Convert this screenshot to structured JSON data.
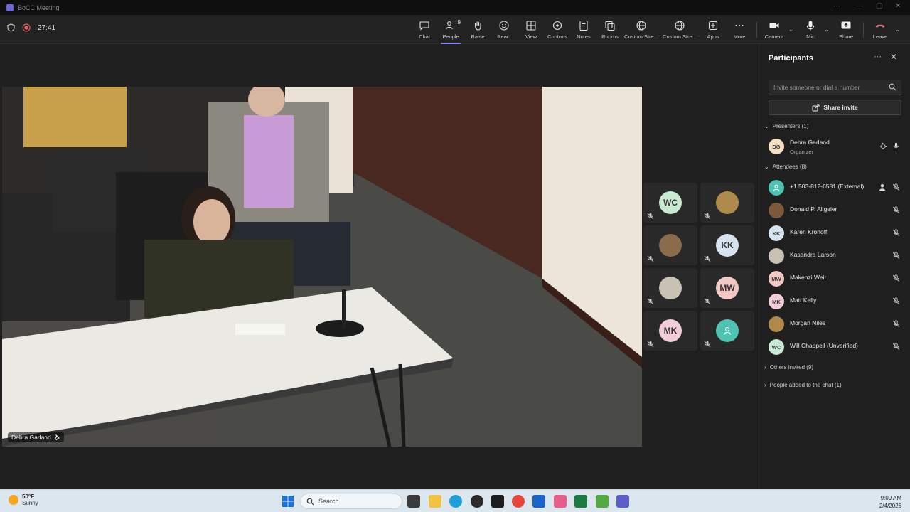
{
  "window": {
    "title": "BoCC Meeting"
  },
  "toolbar": {
    "timer": "27:41",
    "buttons": [
      {
        "label": "Chat",
        "icon": "chat-icon"
      },
      {
        "label": "People",
        "icon": "people-icon",
        "badge": "9",
        "active": true
      },
      {
        "label": "Raise",
        "icon": "raise-hand-icon"
      },
      {
        "label": "React",
        "icon": "react-icon"
      },
      {
        "label": "View",
        "icon": "view-icon"
      },
      {
        "label": "Controls",
        "icon": "controls-icon"
      },
      {
        "label": "Notes",
        "icon": "notes-icon"
      },
      {
        "label": "Rooms",
        "icon": "rooms-icon"
      },
      {
        "label": "Custom Stre...",
        "icon": "globe-icon"
      },
      {
        "label": "Custom Stre...",
        "icon": "globe-icon"
      },
      {
        "label": "Apps",
        "icon": "apps-icon"
      },
      {
        "label": "More",
        "icon": "more-icon"
      }
    ],
    "camera_label": "Camera",
    "mic_label": "Mic",
    "share_label": "Share",
    "leave_label": "Leave",
    "leave_color": "#f1707b"
  },
  "main_video": {
    "speaker_name": "Debra Garland"
  },
  "gallery": [
    {
      "initials": "WC",
      "color": "#c8ead2",
      "photo": false
    },
    {
      "initials": "",
      "color": "#b08a4a",
      "photo": true
    },
    {
      "initials": "",
      "color": "#8a6b4a",
      "photo": true
    },
    {
      "initials": "KK",
      "color": "#d8e3f0",
      "photo": false
    },
    {
      "initials": "",
      "color": "#c9c2b4",
      "photo": true
    },
    {
      "initials": "MW",
      "color": "#f3c9c6",
      "photo": false
    },
    {
      "initials": "MK",
      "color": "#f3ccd9",
      "photo": false
    },
    {
      "initials": "",
      "color": "#4fc3b2",
      "photo": false,
      "icon": "person-icon"
    }
  ],
  "participants_panel": {
    "title": "Participants",
    "invite_placeholder": "Invite someone or dial a number",
    "share_invite_label": "Share invite",
    "presenters_header": "Presenters (1)",
    "presenters": [
      {
        "name": "Debra Garland",
        "role": "Organizer",
        "initials": "DG",
        "color": "#f3dfc4"
      }
    ],
    "attendees_header": "Attendees (8)",
    "attendees": [
      {
        "name": "+1 503-812-6581 (External)",
        "initials": "",
        "color": "#4fc3b2"
      },
      {
        "name": "Donald P. Allgeier",
        "initials": "",
        "color": "#7a5a3a"
      },
      {
        "name": "Karen Kronoff",
        "initials": "KK",
        "color": "#d8e3f0"
      },
      {
        "name": "Kasandra Larson",
        "initials": "",
        "color": "#c9c2b4"
      },
      {
        "name": "Makenzi Weir",
        "initials": "MW",
        "color": "#f3c9c6"
      },
      {
        "name": "Matt Kelly",
        "initials": "MK",
        "color": "#f3ccd9"
      },
      {
        "name": "Morgan Niles",
        "initials": "",
        "color": "#b08a4a"
      },
      {
        "name": "Will Chappell (Unverified)",
        "initials": "WC",
        "color": "#c8ead2"
      }
    ],
    "others_invited": "Others invited (9)",
    "people_added": "People added to the chat (1)"
  },
  "taskbar": {
    "weather_temp": "50°F",
    "weather_desc": "Sunny",
    "search_placeholder": "Search",
    "time": "9:09 AM",
    "date": "2/4/2026"
  }
}
